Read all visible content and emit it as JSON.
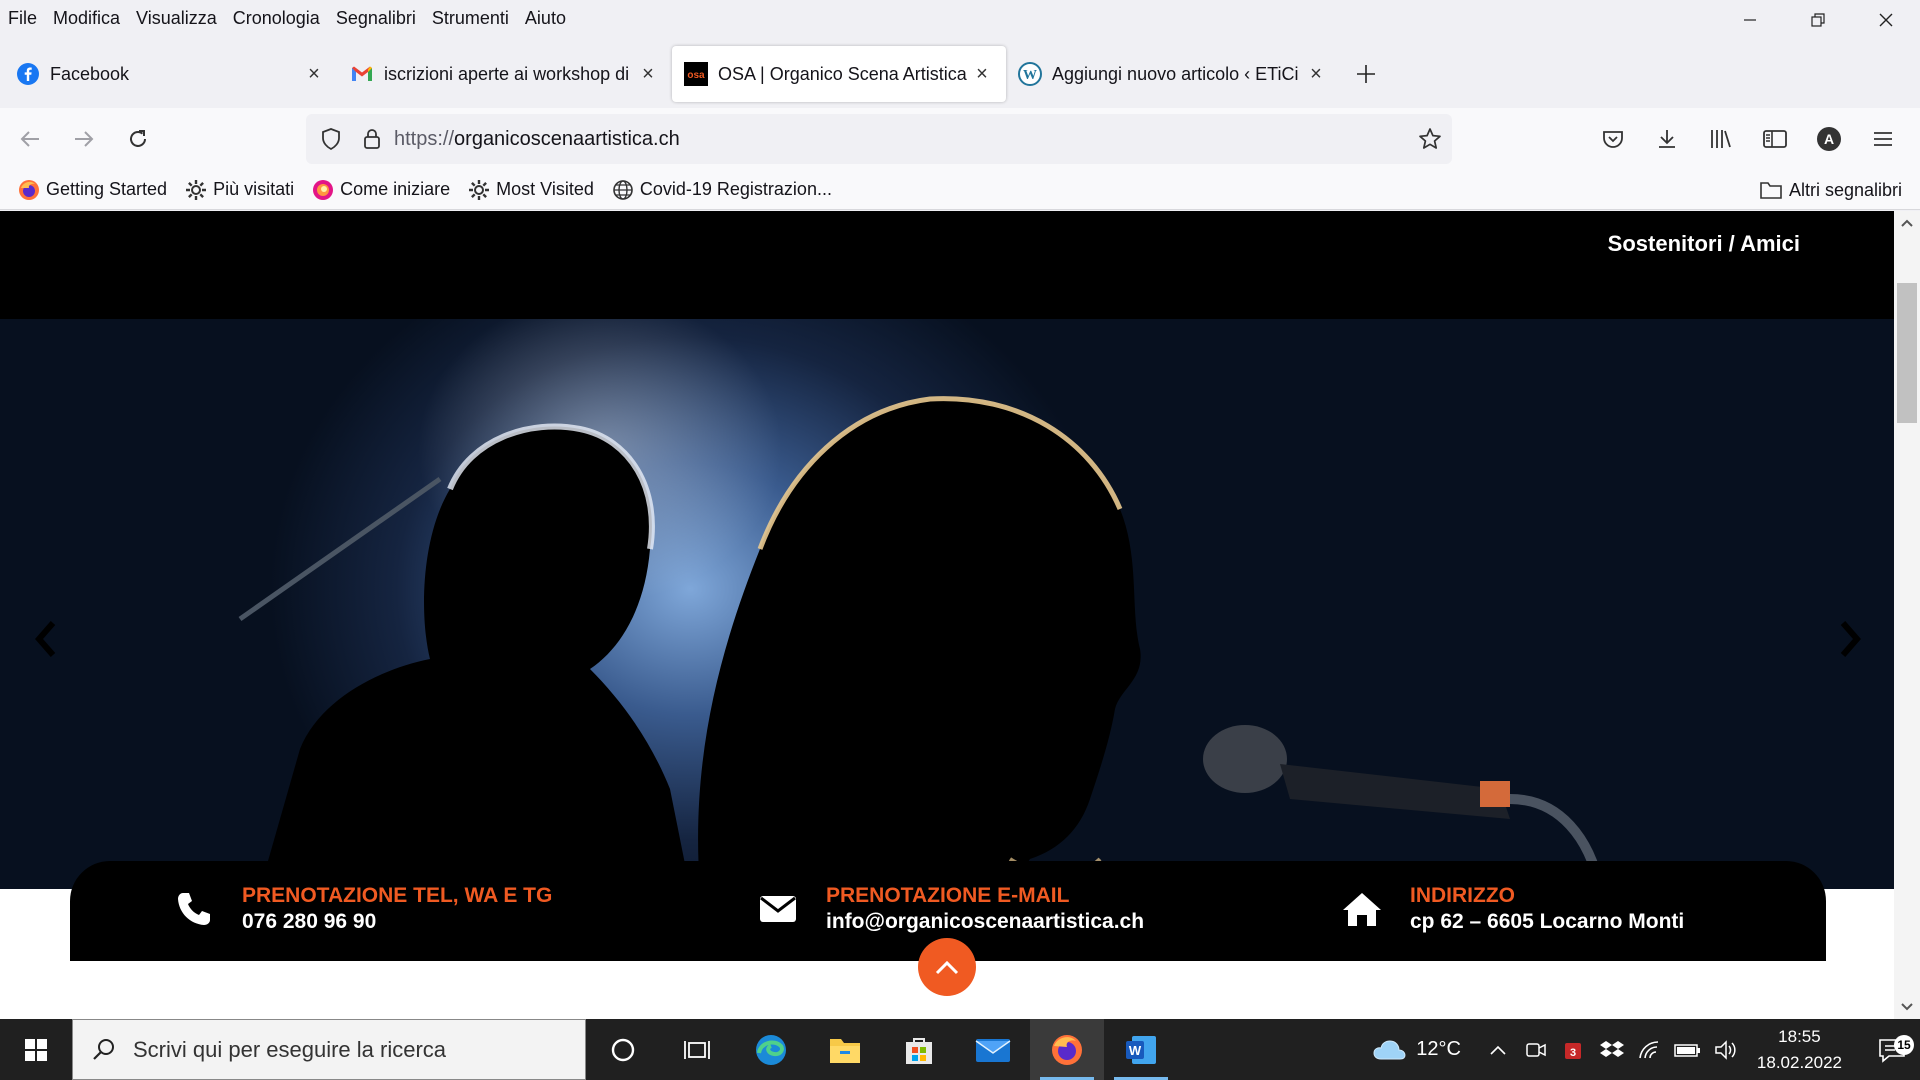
{
  "menubar": {
    "items": [
      "File",
      "Modifica",
      "Visualizza",
      "Cronologia",
      "Segnalibri",
      "Strumenti",
      "Aiuto"
    ]
  },
  "tabs": [
    {
      "title": "Facebook",
      "icon": "facebook-icon"
    },
    {
      "title": "iscrizioni aperte ai workshop di",
      "icon": "gmail-icon"
    },
    {
      "title": "OSA | Organico Scena Artistica",
      "icon": "osa-icon"
    },
    {
      "title": "Aggiungi nuovo articolo ‹ ETiCi",
      "icon": "wordpress-icon"
    }
  ],
  "navbar": {
    "url_scheme": "https://",
    "url_host": "organicoscenaartistica.ch",
    "account_initial": "A"
  },
  "bookmarks": {
    "items": [
      {
        "label": "Getting Started",
        "icon": "firefox-icon"
      },
      {
        "label": "Più visitati",
        "icon": "gear-icon"
      },
      {
        "label": "Come iniziare",
        "icon": "firefox-logo-icon"
      },
      {
        "label": "Most Visited",
        "icon": "gear-icon"
      },
      {
        "label": "Covid-19 Registrazion...",
        "icon": "globe-icon"
      }
    ],
    "other": "Altri segnalibri"
  },
  "site": {
    "nav_link": "Sostenitori / Amici",
    "contacts": [
      {
        "title": "PRENOTAZIONE TEL, WA E TG",
        "value": "076 280 96 90",
        "icon": "phone-icon"
      },
      {
        "title": "PRENOTAZIONE E-MAIL",
        "value": "info@organicoscenaartistica.ch",
        "icon": "envelope-icon"
      },
      {
        "title": "INDIRIZZO",
        "value": "cp 62 – 6605 Locarno Monti",
        "icon": "home-icon"
      }
    ],
    "accent_color": "#f05a22"
  },
  "taskbar": {
    "search_placeholder": "Scrivi qui per eseguire la ricerca",
    "temperature": "12°C",
    "time": "18:55",
    "date": "18.02.2022",
    "notification_count": "15"
  }
}
